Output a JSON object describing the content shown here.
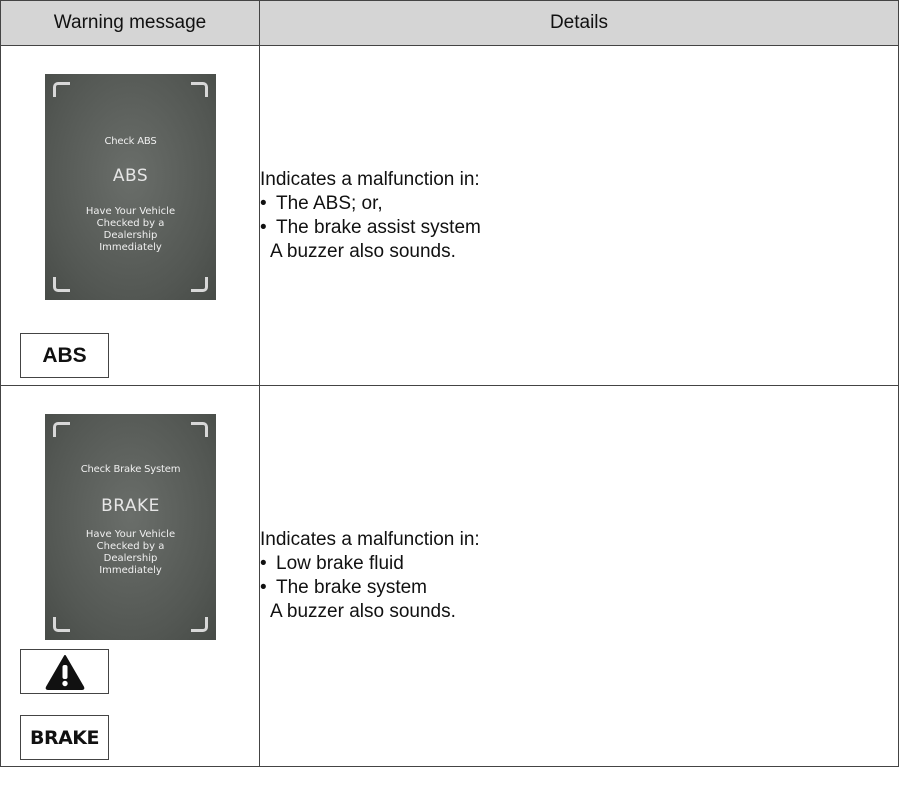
{
  "table": {
    "headers": {
      "message": "Warning message",
      "details": "Details"
    },
    "rows": [
      {
        "screen": {
          "title": "Check ABS",
          "code": "ABS",
          "body": [
            "Have Your Vehicle",
            "Checked by a",
            "Dealership",
            "Immediately"
          ]
        },
        "lamps": [
          {
            "type": "text",
            "label": "ABS"
          }
        ],
        "details": {
          "intro": "Indicates a malfunction in:",
          "bullets": [
            "The ABS; or,",
            "The brake assist system"
          ],
          "note": "A buzzer also sounds."
        }
      },
      {
        "screen": {
          "title": "Check Brake System",
          "code": "BRAKE",
          "body": [
            "Have Your Vehicle",
            "Checked by a",
            "Dealership",
            "Immediately"
          ]
        },
        "lamps": [
          {
            "type": "icon",
            "icon": "warning-triangle-icon"
          },
          {
            "type": "text",
            "label": "BRAKE"
          }
        ],
        "details": {
          "intro": "Indicates a malfunction in:",
          "bullets": [
            "Low brake fluid",
            "The brake system"
          ],
          "note": "A buzzer also sounds."
        }
      }
    ]
  },
  "colors": {
    "header_bg": "#d5d5d5",
    "border": "#444444",
    "screen_bg": "#5a5e5a"
  }
}
